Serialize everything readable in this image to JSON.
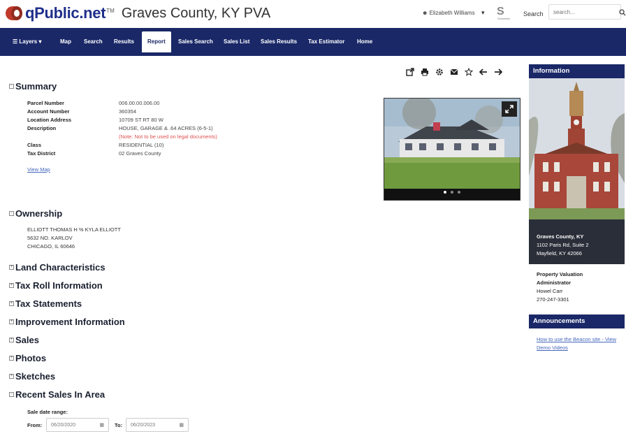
{
  "header": {
    "brand": "qPublic.net",
    "trademark": "TM",
    "county": "Graves County, KY PVA",
    "user": "Elizabeth Williams",
    "schneider_label": "Schneider",
    "search_label": "Search",
    "search_placeholder": "search..."
  },
  "nav": {
    "layers": "Layers",
    "items": [
      "Map",
      "Search",
      "Results",
      "Report",
      "Sales Search",
      "Sales List",
      "Sales Results",
      "Tax Estimator",
      "Home"
    ],
    "active": "Report"
  },
  "summary": {
    "title": "Summary",
    "rows": [
      {
        "label": "Parcel Number",
        "value": "006.00.00.006.00"
      },
      {
        "label": "Account Number",
        "value": "360354"
      },
      {
        "label": "Location Address",
        "value": "10709 ST RT 80 W"
      },
      {
        "label": "Description",
        "value": "HOUSE, GARAGE & .64 ACRES (6-5-1)"
      },
      {
        "label": "Class",
        "value": "RESIDENTIAL (10)"
      },
      {
        "label": "Tax District",
        "value": "02 Graves County"
      }
    ],
    "note": "(Note: Not to be used on legal documents)",
    "view_map": "View Map"
  },
  "ownership": {
    "title": "Ownership",
    "lines": [
      "ELLIOTT THOMAS H % KYLA ELLIOTT",
      "5632 NO. KARLOV",
      "CHICAGO, IL 60646"
    ]
  },
  "sections": [
    "Land Characteristics",
    "Tax Roll Information",
    "Tax Statements",
    "Improvement Information",
    "Sales",
    "Photos",
    "Sketches",
    "Recent Sales In Area"
  ],
  "recent_sales": {
    "range_label": "Sale date range:",
    "from_label": "From:",
    "from_value": "06/20/2020",
    "to_label": "To:",
    "to_value": "06/20/2023"
  },
  "sidebar": {
    "info_title": "Information",
    "caption": [
      "Graves County, KY",
      "1102 Paris Rd, Suite 2",
      "Mayfield, KY 42066"
    ],
    "pva": [
      "Property Valuation",
      "Administrator",
      "Howel Carr",
      "270-247-3301"
    ],
    "announcements_title": "Announcements",
    "announcement_link": [
      "How to use the Beacon site - View",
      "Demo Videos"
    ]
  },
  "colors": {
    "navy": "#1a2868",
    "brand_blue": "#1f2f8a",
    "brand_red": "#c0392b",
    "note_red": "#e05050",
    "link_blue": "#4466bb"
  }
}
